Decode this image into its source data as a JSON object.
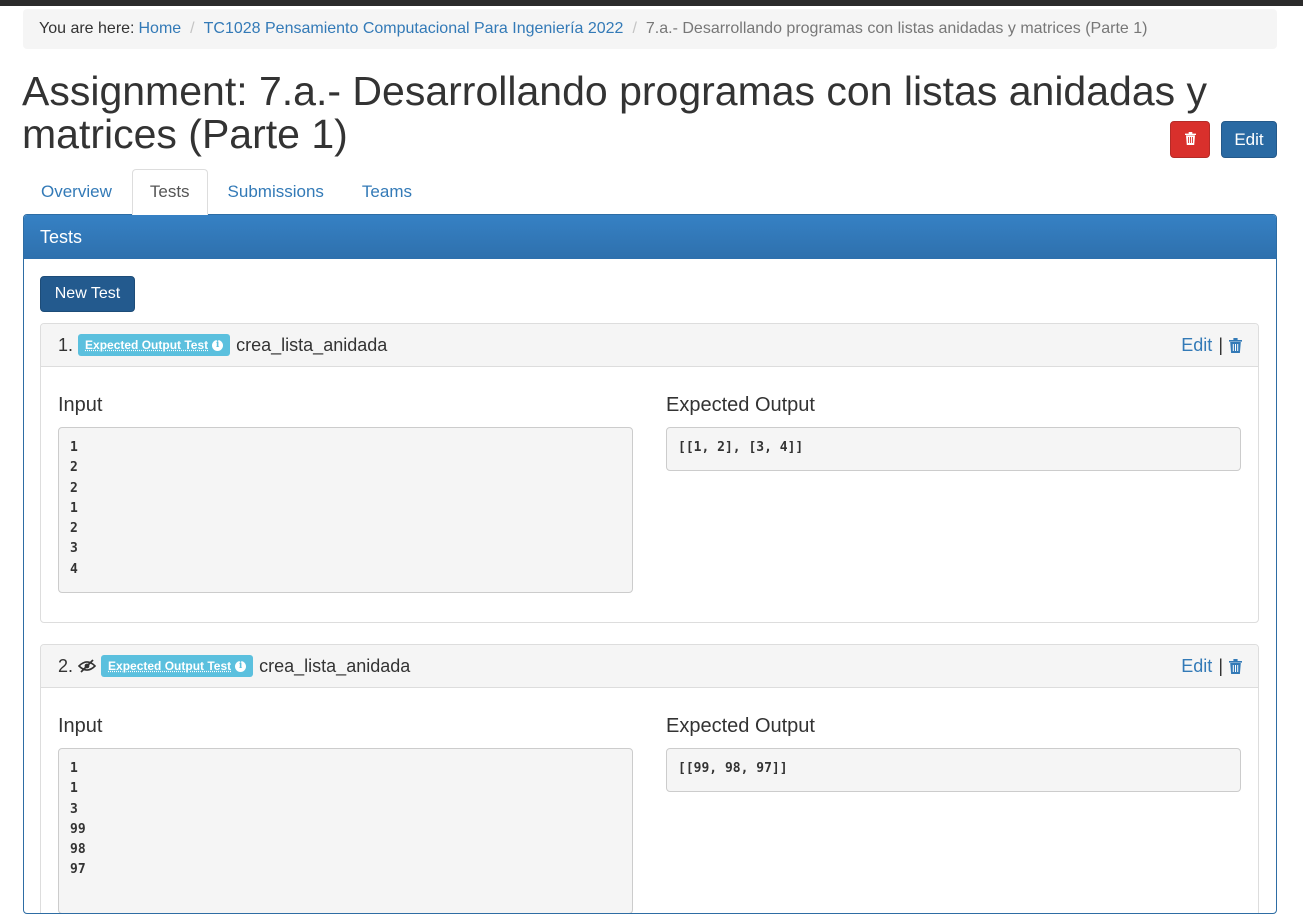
{
  "breadcrumb": {
    "lead": "You are here:",
    "items": [
      "Home",
      "TC1028 Pensamiento Computacional Para Ingeniería 2022"
    ],
    "current": "7.a.- Desarrollando programas con listas anidadas y matrices (Parte 1)"
  },
  "page": {
    "title": "Assignment: 7.a.- Desarrollando programas con listas anidadas y matrices (Parte 1)",
    "delete_icon": "trash-icon",
    "edit_label": "Edit"
  },
  "tabs": [
    "Overview",
    "Tests",
    "Submissions",
    "Teams"
  ],
  "active_tab": "Tests",
  "panel": {
    "heading": "Tests",
    "new_test_label": "New Test"
  },
  "tests": [
    {
      "number": "1.",
      "hidden": false,
      "badge": "Expected Output Test",
      "name": "crea_lista_anidada",
      "edit_label": "Edit",
      "separator": "|",
      "input_label": "Input",
      "output_label": "Expected Output",
      "input": "1\n2\n2\n1\n2\n3\n4",
      "expected_output": "[[1, 2], [3, 4]]"
    },
    {
      "number": "2.",
      "hidden": true,
      "badge": "Expected Output Test",
      "name": "crea_lista_anidada",
      "edit_label": "Edit",
      "separator": "|",
      "input_label": "Input",
      "output_label": "Expected Output",
      "input": "1\n1\n3\n99\n98\n97",
      "expected_output": "[[99, 98, 97]]"
    }
  ],
  "colors": {
    "link": "#337ab7",
    "danger": "#d9302c",
    "primary": "#2a6aa3",
    "panel_heading": "#337ab7",
    "badge_info": "#5bc0de"
  }
}
